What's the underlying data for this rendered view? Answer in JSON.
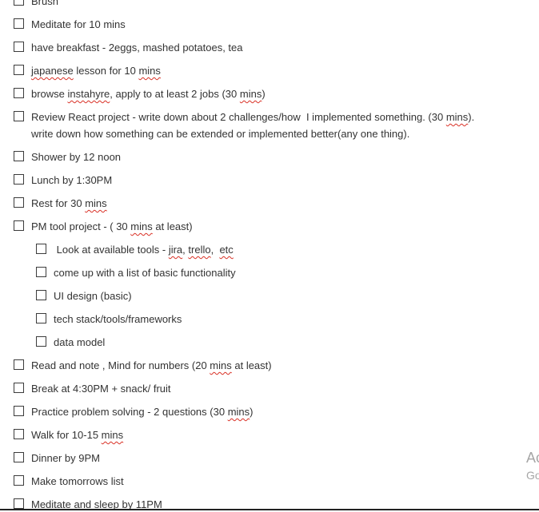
{
  "todo_list": {
    "items": [
      {
        "level": 0,
        "parts": [
          {
            "t": "Brush"
          }
        ]
      },
      {
        "level": 0,
        "parts": [
          {
            "t": "Meditate for 10 mins"
          }
        ]
      },
      {
        "level": 0,
        "parts": [
          {
            "t": "have breakfast - 2eggs, mashed potatoes, tea"
          }
        ]
      },
      {
        "level": 0,
        "parts": [
          {
            "t": "japanese",
            "sq": true
          },
          {
            "t": " lesson for 10 "
          },
          {
            "t": "mins",
            "sq": true
          }
        ]
      },
      {
        "level": 0,
        "parts": [
          {
            "t": "browse "
          },
          {
            "t": "instahyre",
            "sq": true
          },
          {
            "t": ", apply to at least 2 jobs (30 "
          },
          {
            "t": "mins",
            "sq": true
          },
          {
            "t": ")"
          }
        ]
      },
      {
        "level": 0,
        "multiline": true,
        "parts": [
          {
            "t": "Review React project - write down about 2 challenges/how  I implemented something. (30 "
          },
          {
            "t": "mins",
            "sq": true
          },
          {
            "t": ").\nwrite down how something can be extended or implemented better(any one thing)."
          }
        ]
      },
      {
        "level": 0,
        "parts": [
          {
            "t": "Shower by 12 noon"
          }
        ]
      },
      {
        "level": 0,
        "parts": [
          {
            "t": "Lunch by 1:30PM"
          }
        ]
      },
      {
        "level": 0,
        "parts": [
          {
            "t": "Rest for 30 "
          },
          {
            "t": "mins",
            "sq": true
          }
        ]
      },
      {
        "level": 0,
        "parts": [
          {
            "t": "PM tool project - ( 30 "
          },
          {
            "t": "mins",
            "sq": true
          },
          {
            "t": " at least)"
          }
        ]
      },
      {
        "level": 1,
        "parts": [
          {
            "t": " Look at available tools - "
          },
          {
            "t": "jira",
            "sq": true
          },
          {
            "t": ", "
          },
          {
            "t": "trello",
            "sq": true
          },
          {
            "t": ",  "
          },
          {
            "t": "etc",
            "sq": true
          }
        ]
      },
      {
        "level": 1,
        "parts": [
          {
            "t": "come up with a list of basic functionality"
          }
        ]
      },
      {
        "level": 1,
        "parts": [
          {
            "t": "UI design (basic)"
          }
        ]
      },
      {
        "level": 1,
        "parts": [
          {
            "t": "tech stack/tools/frameworks"
          }
        ]
      },
      {
        "level": 1,
        "parts": [
          {
            "t": "data model"
          }
        ]
      },
      {
        "level": 0,
        "parts": [
          {
            "t": "Read and note , Mind for numbers (20 "
          },
          {
            "t": "mins",
            "sq": true
          },
          {
            "t": " at least)"
          }
        ]
      },
      {
        "level": 0,
        "parts": [
          {
            "t": "Break at 4:30PM + snack/ fruit"
          }
        ]
      },
      {
        "level": 0,
        "parts": [
          {
            "t": "Practice problem solving - 2 questions (30 "
          },
          {
            "t": "mins",
            "sq": true
          },
          {
            "t": ")"
          }
        ]
      },
      {
        "level": 0,
        "parts": [
          {
            "t": "Walk for 10-15 "
          },
          {
            "t": "mins",
            "sq": true
          }
        ]
      },
      {
        "level": 0,
        "parts": [
          {
            "t": "Dinner by 9PM"
          }
        ]
      },
      {
        "level": 0,
        "parts": [
          {
            "t": "Make tomorrows list"
          }
        ]
      },
      {
        "level": 0,
        "parts": [
          {
            "t": "Meditate and sleep by 11PM"
          }
        ]
      }
    ]
  },
  "watermark": {
    "line1": "Ac",
    "line2": "Go"
  },
  "colors": {
    "text": "#333333",
    "checkbox_border": "#3c3c3c",
    "spellcheck": "#d93025",
    "watermark": "#a6a6a6"
  },
  "icons": {
    "checkbox": "empty-square-checkbox-icon"
  }
}
